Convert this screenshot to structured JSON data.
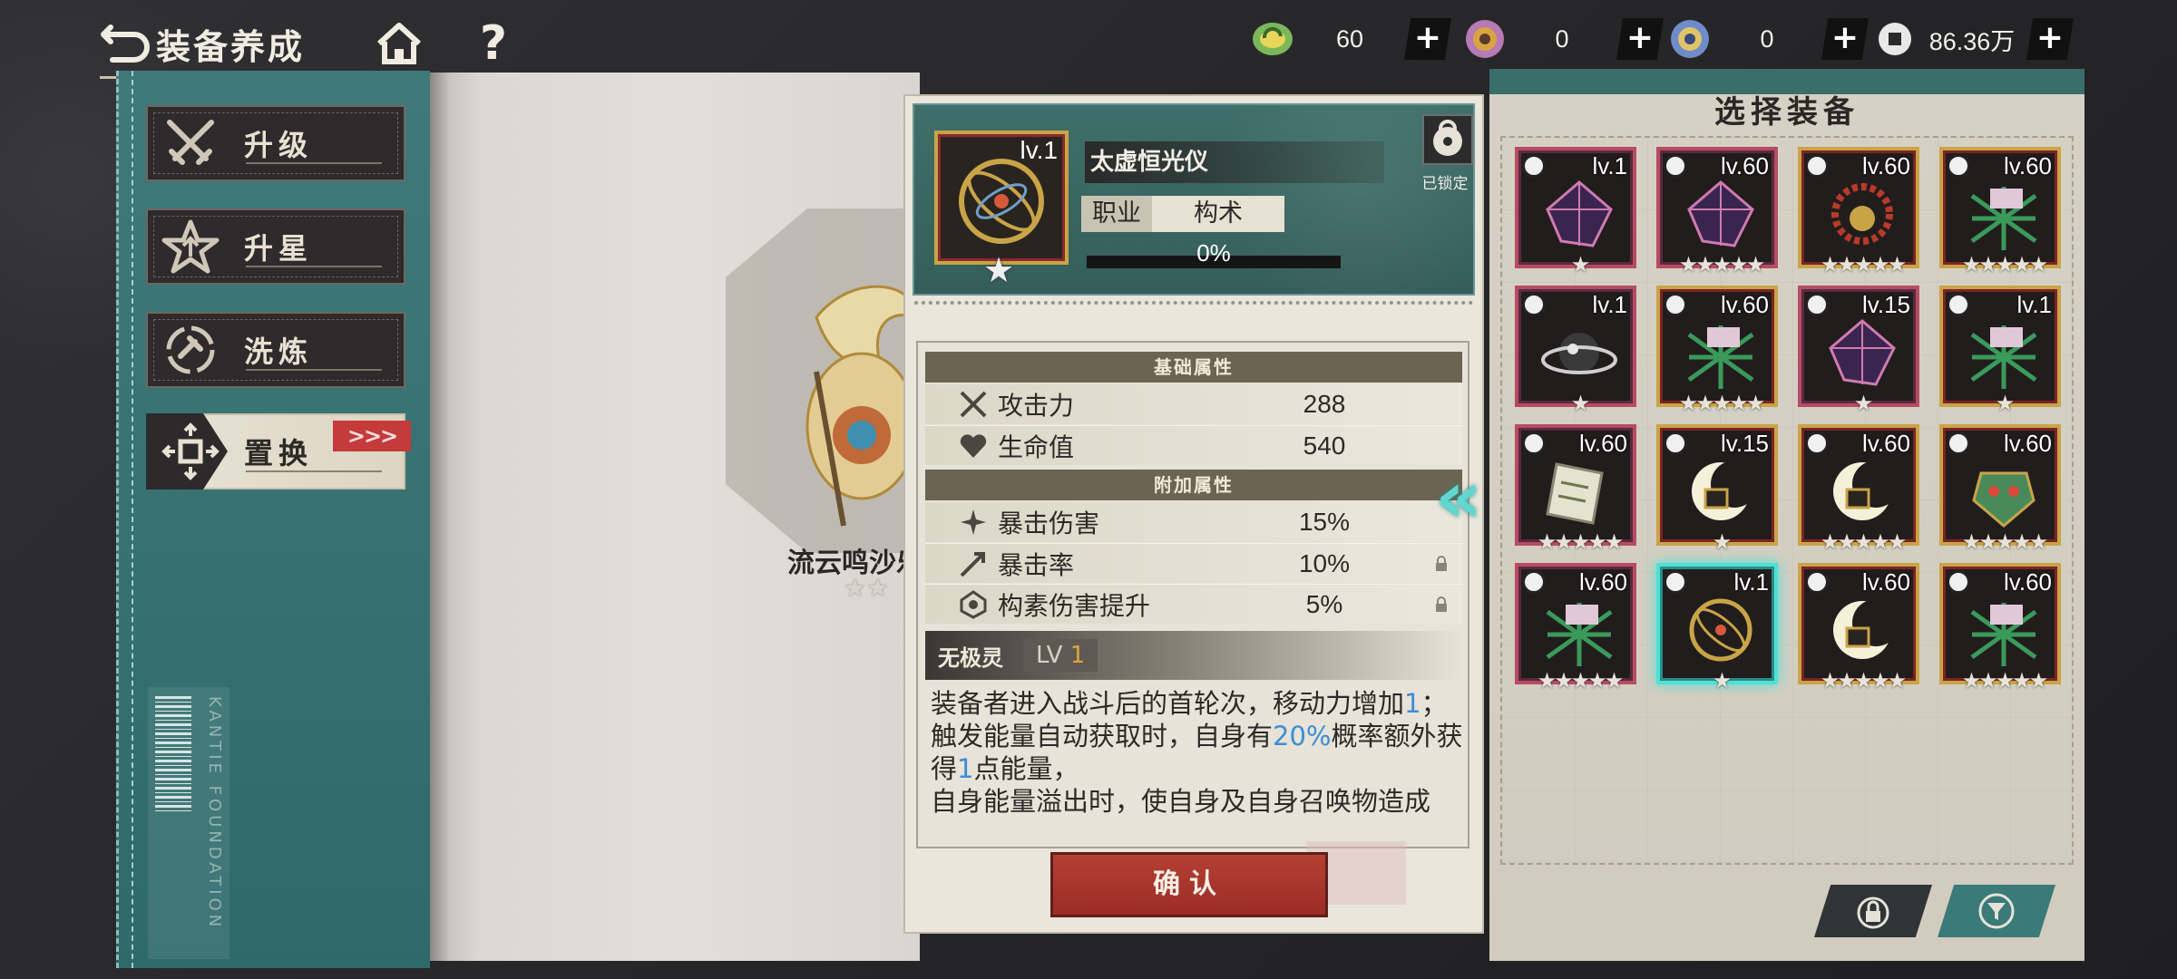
{
  "header": {
    "title": "装备养成",
    "help_label": "?"
  },
  "currencies": [
    {
      "icon": "green-crystal-icon",
      "value": "60",
      "plus": "+"
    },
    {
      "icon": "pink-token-icon",
      "value": "0",
      "plus": "+"
    },
    {
      "icon": "blue-token-icon",
      "value": "0",
      "plus": "+"
    },
    {
      "icon": "silver-coin-icon",
      "value": "86.36万",
      "plus": "+"
    }
  ],
  "sidebar": {
    "items": [
      {
        "label": "升级",
        "icon": "crossed-swords-icon"
      },
      {
        "label": "升星",
        "icon": "star-up-icon"
      },
      {
        "label": "洗炼",
        "icon": "refine-icon"
      },
      {
        "label": "置换",
        "icon": "swap-icon",
        "active": true,
        "arrows": ">>>"
      }
    ],
    "barcode_text": "KANTIE FOUNDATION"
  },
  "character": {
    "name": "流云鸣沙乐",
    "stars": "★★"
  },
  "detail": {
    "level": "lv.1",
    "item_name": "太虚恒光仪",
    "job_label": "职业",
    "job_value": "构术",
    "progress_text": "0%",
    "progress": 0,
    "lock_label": "已锁定",
    "base_section": "基础属性",
    "base_attrs": [
      {
        "name": "攻击力",
        "value": "288",
        "icon": "attack-icon"
      },
      {
        "name": "生命值",
        "value": "540",
        "icon": "heart-icon"
      }
    ],
    "extra_section": "附加属性",
    "extra_attrs": [
      {
        "name": "暴击伤害",
        "value": "15%",
        "icon": "crit-damage-icon"
      },
      {
        "name": "暴击率",
        "value": "10%",
        "icon": "crit-rate-icon"
      },
      {
        "name": "构素伤害提升",
        "value": "5%",
        "icon": "element-damage-icon"
      }
    ],
    "skill_name": "无极灵",
    "skill_lv_prefix": "LV ",
    "skill_lv_num": "1",
    "skill_text_1": "装备者进入战斗后的首轮次，移动力增加",
    "skill_val_1": "1",
    "skill_text_2": "；",
    "skill_text_3": "触发能量自动获取时，自身有",
    "skill_val_2": "20%",
    "skill_text_4": "概率额外获得",
    "skill_val_3": "1",
    "skill_text_5": "点能量，",
    "skill_text_6": "自身能量溢出时，使自身及自身召唤物造成"
  },
  "confirm_label": "确认",
  "swap_arrows": "«",
  "equipment_panel": {
    "title": "选择装备",
    "items": [
      {
        "level": "lv.1",
        "frame": "purple",
        "art": "purple-crystal-icon",
        "stars": "★"
      },
      {
        "level": "lv.60",
        "frame": "purple",
        "art": "purple-crystal-icon",
        "stars": "★★★★★"
      },
      {
        "level": "lv.60",
        "frame": "gold",
        "art": "bead-necklace-icon",
        "stars": "★★★★★"
      },
      {
        "level": "lv.60",
        "frame": "gold",
        "art": "green-lattice-icon",
        "stars": "★★★★★"
      },
      {
        "level": "lv.1",
        "frame": "purple",
        "art": "orb-ring-icon",
        "stars": "★"
      },
      {
        "level": "lv.60",
        "frame": "gold",
        "art": "green-lattice-icon",
        "stars": "★★★★★"
      },
      {
        "level": "lv.15",
        "frame": "purple",
        "art": "purple-crystal-icon",
        "stars": "★"
      },
      {
        "level": "lv.1",
        "frame": "gold",
        "art": "green-lattice-icon",
        "stars": "★"
      },
      {
        "level": "lv.60",
        "frame": "purple",
        "art": "scroll-icon",
        "stars": "★★★★★"
      },
      {
        "level": "lv.15",
        "frame": "gold",
        "art": "moon-orb-icon",
        "stars": "★"
      },
      {
        "level": "lv.60",
        "frame": "gold",
        "art": "moon-orb-icon",
        "stars": "★★★★★"
      },
      {
        "level": "lv.60",
        "frame": "gold",
        "art": "dragon-mask-icon",
        "stars": "★★★★★"
      },
      {
        "level": "lv.60",
        "frame": "purple",
        "art": "green-lattice-icon",
        "stars": "★★★★★"
      },
      {
        "level": "lv.1",
        "frame": "selected",
        "art": "astrolabe-icon",
        "stars": "★"
      },
      {
        "level": "lv.60",
        "frame": "gold",
        "art": "moon-orb-icon",
        "stars": "★★★★★"
      },
      {
        "level": "lv.60",
        "frame": "gold",
        "art": "green-lattice-icon",
        "stars": "★★★★★"
      }
    ]
  },
  "colors": {
    "teal": "#3f7a7a",
    "gold": "#c9a447",
    "red": "#b54034",
    "cyan": "#4fe0d6",
    "highlight_blue": "#3b8ed6"
  }
}
